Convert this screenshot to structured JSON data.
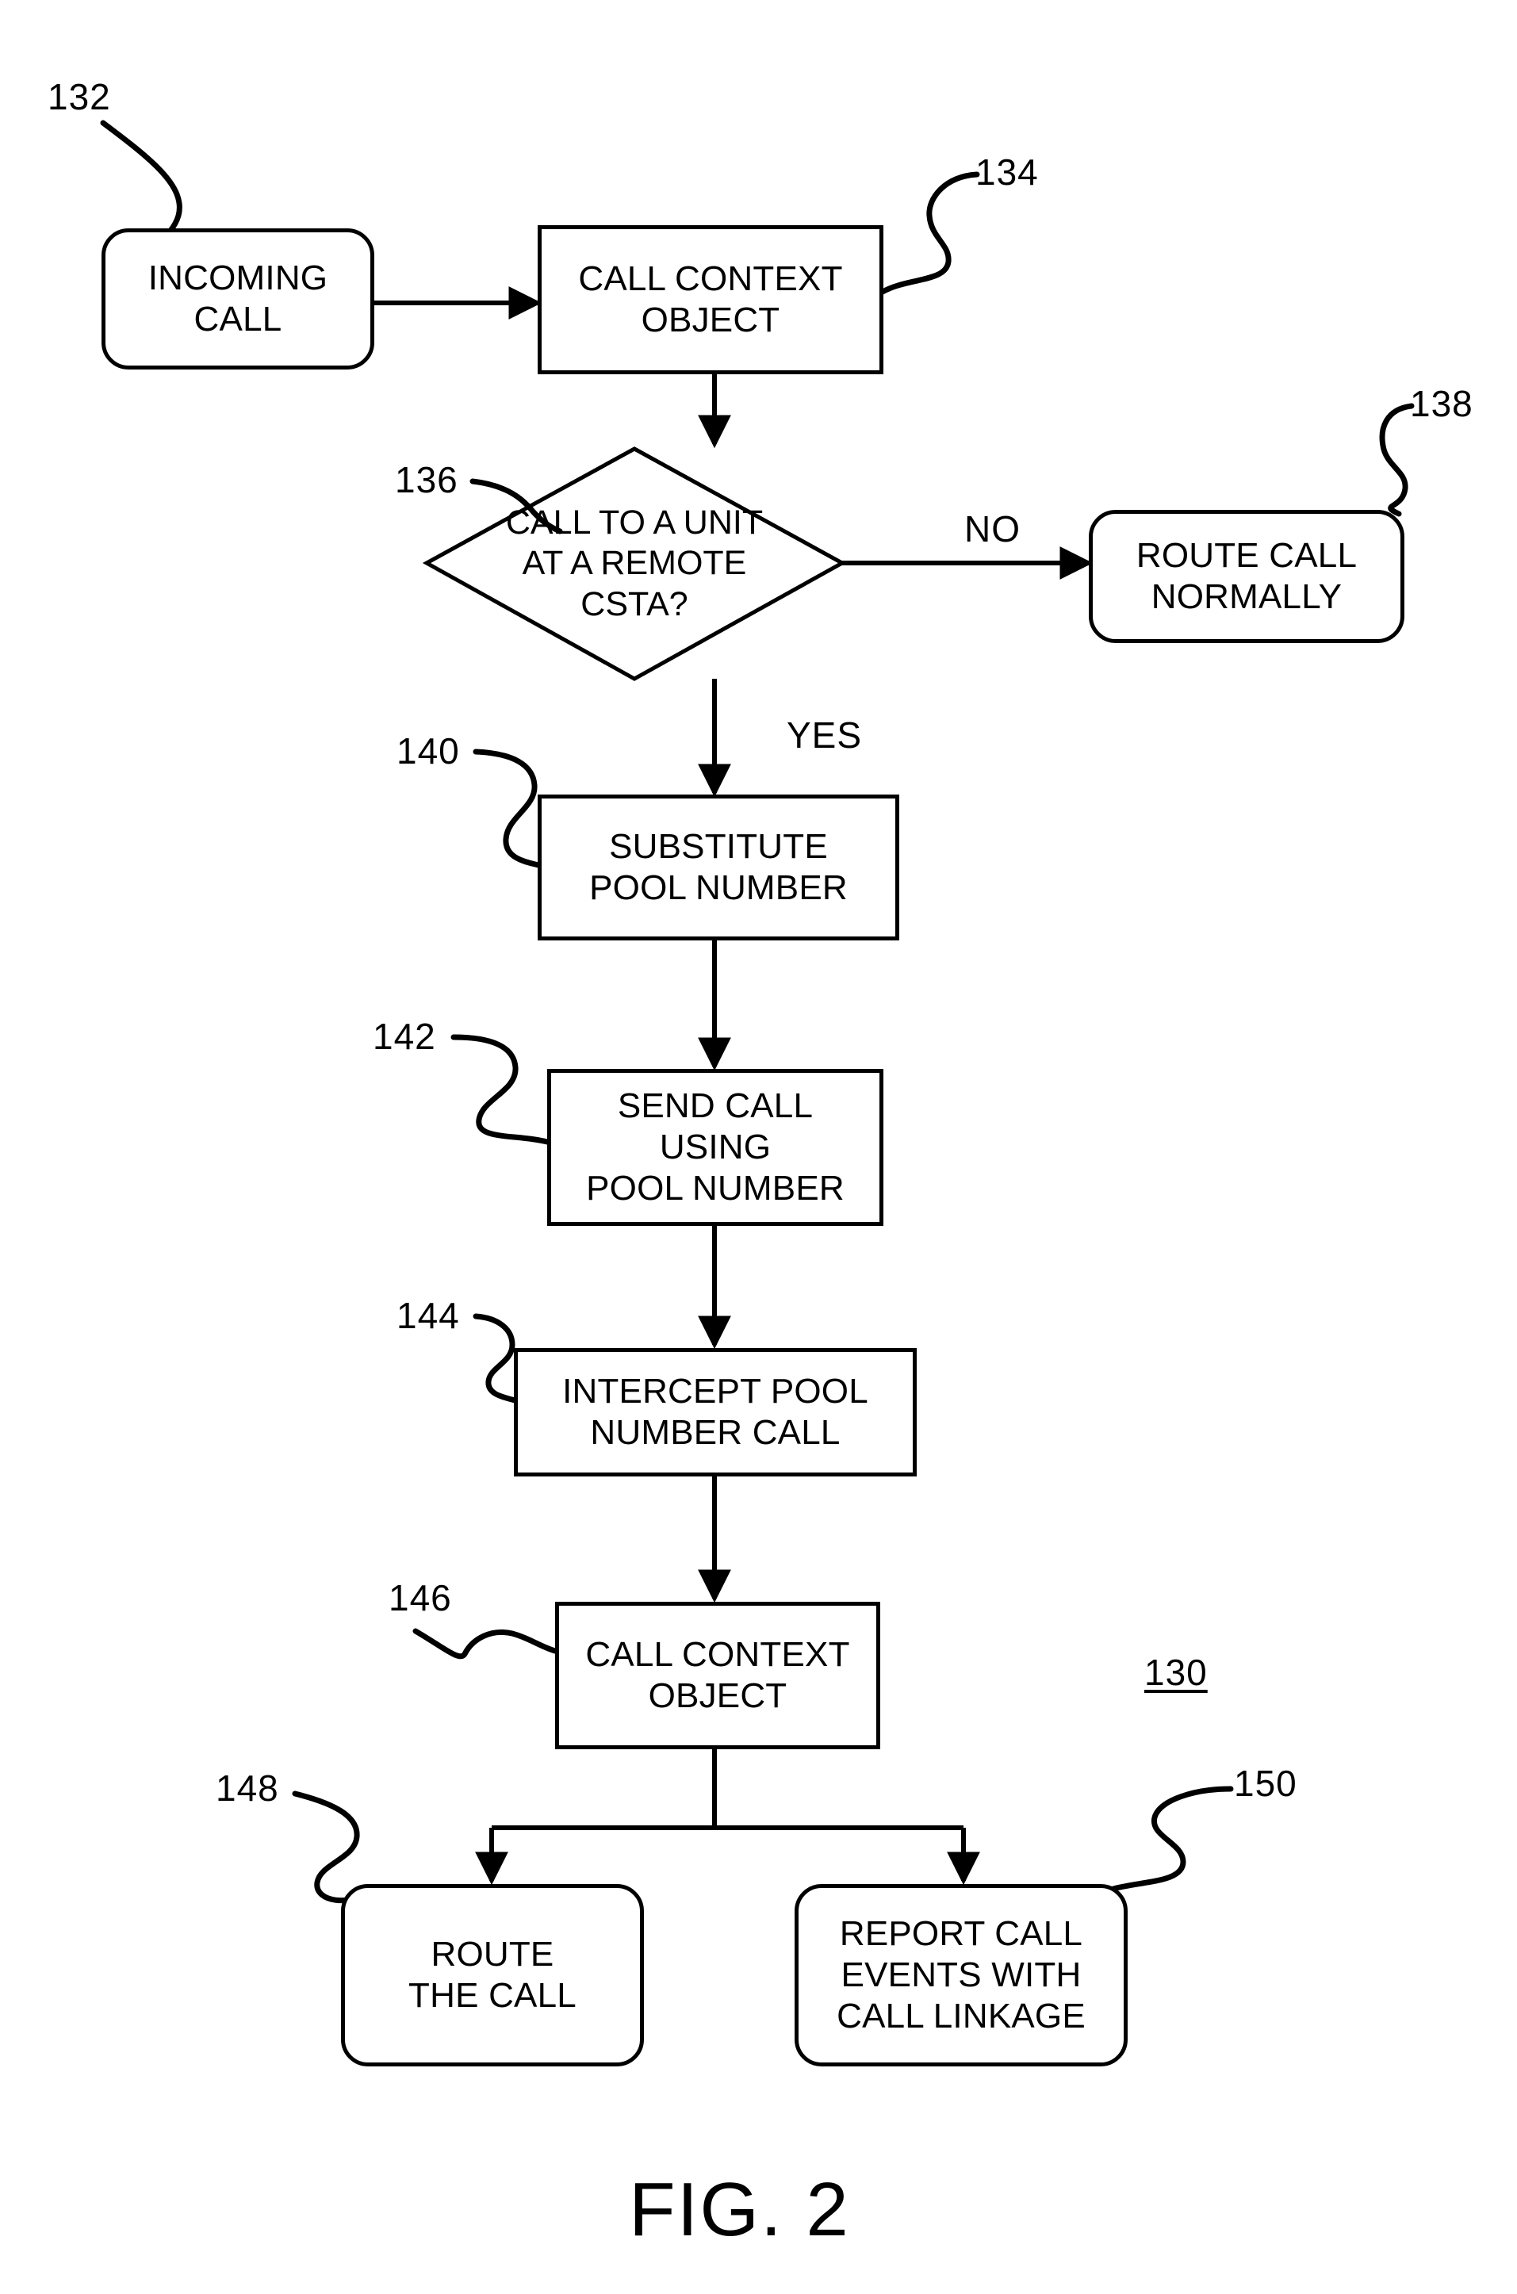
{
  "figure": {
    "caption": "FIG. 2",
    "diagram_ref": "130"
  },
  "nodes": {
    "incoming_call": {
      "ref": "132",
      "text_line1": "INCOMING",
      "text_line2": "CALL",
      "shape": "rounded-rect"
    },
    "call_context_object_top": {
      "ref": "134",
      "text_line1": "CALL CONTEXT",
      "text_line2": "OBJECT",
      "shape": "rect"
    },
    "decision": {
      "ref": "136",
      "text_line1": "CALL TO A UNIT",
      "text_line2": "AT A REMOTE",
      "text_line3": "CSTA?",
      "shape": "diamond"
    },
    "route_call_normally": {
      "ref": "138",
      "text_line1": "ROUTE CALL",
      "text_line2": "NORMALLY",
      "shape": "rounded-rect"
    },
    "substitute_pool_number": {
      "ref": "140",
      "text_line1": "SUBSTITUTE",
      "text_line2": "POOL NUMBER",
      "shape": "rect"
    },
    "send_call_using_pool_number": {
      "ref": "142",
      "text_line1": "SEND CALL",
      "text_line2": "USING",
      "text_line3": "POOL NUMBER",
      "shape": "rect"
    },
    "intercept_pool_number_call": {
      "ref": "144",
      "text_line1": "INTERCEPT POOL",
      "text_line2": "NUMBER CALL",
      "shape": "rect"
    },
    "call_context_object_bottom": {
      "ref": "146",
      "text_line1": "CALL CONTEXT",
      "text_line2": "OBJECT",
      "shape": "rect"
    },
    "route_the_call": {
      "ref": "148",
      "text_line1": "ROUTE",
      "text_line2": "THE CALL",
      "shape": "rounded-rect"
    },
    "report_call_events": {
      "ref": "150",
      "text_line1": "REPORT CALL",
      "text_line2": "EVENTS WITH",
      "text_line3": "CALL LINKAGE",
      "shape": "rounded-rect"
    }
  },
  "branch_labels": {
    "no": "NO",
    "yes": "YES"
  },
  "colors": {
    "ink": "#000000",
    "paper": "#ffffff"
  }
}
